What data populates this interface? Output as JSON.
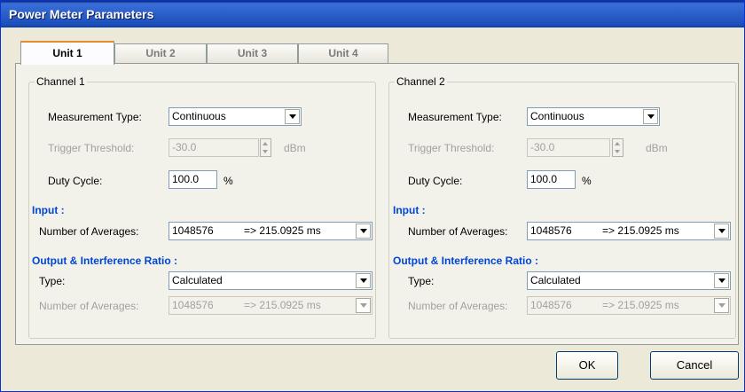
{
  "window": {
    "title": "Power Meter Parameters"
  },
  "tabs": [
    "Unit 1",
    "Unit 2",
    "Unit 3",
    "Unit 4"
  ],
  "channels": [
    {
      "title": "Channel 1",
      "measurement_type_label": "Measurement Type:",
      "measurement_type_value": "Continuous",
      "trigger_threshold_label": "Trigger Threshold:",
      "trigger_threshold_value": "-30.0",
      "trigger_threshold_unit": "dBm",
      "duty_cycle_label": "Duty Cycle:",
      "duty_cycle_value": "100.0",
      "duty_cycle_unit": "%",
      "input_heading": "Input :",
      "input_averages_label": "Number of Averages:",
      "input_averages_value": "1048576",
      "input_averages_time": "=> 215.0925 ms",
      "output_heading": "Output & Interference Ratio :",
      "type_label": "Type:",
      "type_value": "Calculated",
      "output_averages_label": "Number of Averages:",
      "output_averages_value": "1048576",
      "output_averages_time": "=> 215.0925 ms"
    },
    {
      "title": "Channel 2",
      "measurement_type_label": "Measurement Type:",
      "measurement_type_value": "Continuous",
      "trigger_threshold_label": "Trigger Threshold:",
      "trigger_threshold_value": "-30.0",
      "trigger_threshold_unit": "dBm",
      "duty_cycle_label": "Duty Cycle:",
      "duty_cycle_value": "100.0",
      "duty_cycle_unit": "%",
      "input_heading": "Input :",
      "input_averages_label": "Number of Averages:",
      "input_averages_value": "1048576",
      "input_averages_time": "=> 215.0925 ms",
      "output_heading": "Output & Interference Ratio :",
      "type_label": "Type:",
      "type_value": "Calculated",
      "output_averages_label": "Number of Averages:",
      "output_averages_value": "1048576",
      "output_averages_time": "=> 215.0925 ms"
    }
  ],
  "buttons": {
    "ok": "OK",
    "cancel": "Cancel"
  },
  "colors": {
    "section_heading": "#0046d5",
    "titlebar": "#2b5ec9",
    "active_tab_accent": "#e68b2c"
  }
}
